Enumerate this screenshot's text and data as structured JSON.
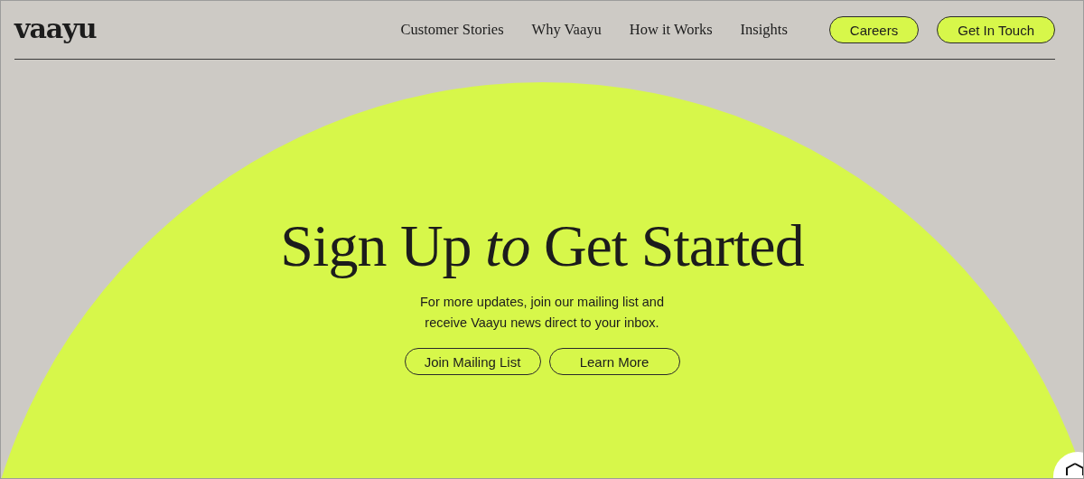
{
  "header": {
    "logo": "vaayu",
    "nav": [
      {
        "label": "Customer Stories"
      },
      {
        "label": "Why Vaayu"
      },
      {
        "label": "How it Works"
      },
      {
        "label": "Insights"
      }
    ],
    "buttons": [
      {
        "label": "Careers"
      },
      {
        "label": "Get In Touch"
      }
    ]
  },
  "hero": {
    "title": "Sign Up *to* Get Started",
    "text": "For more updates, join our mailing list and receive Vaayu news direct to your inbox.",
    "buttons": [
      {
        "label": "Join Mailing List"
      },
      {
        "label": "Learn More"
      }
    ]
  }
}
